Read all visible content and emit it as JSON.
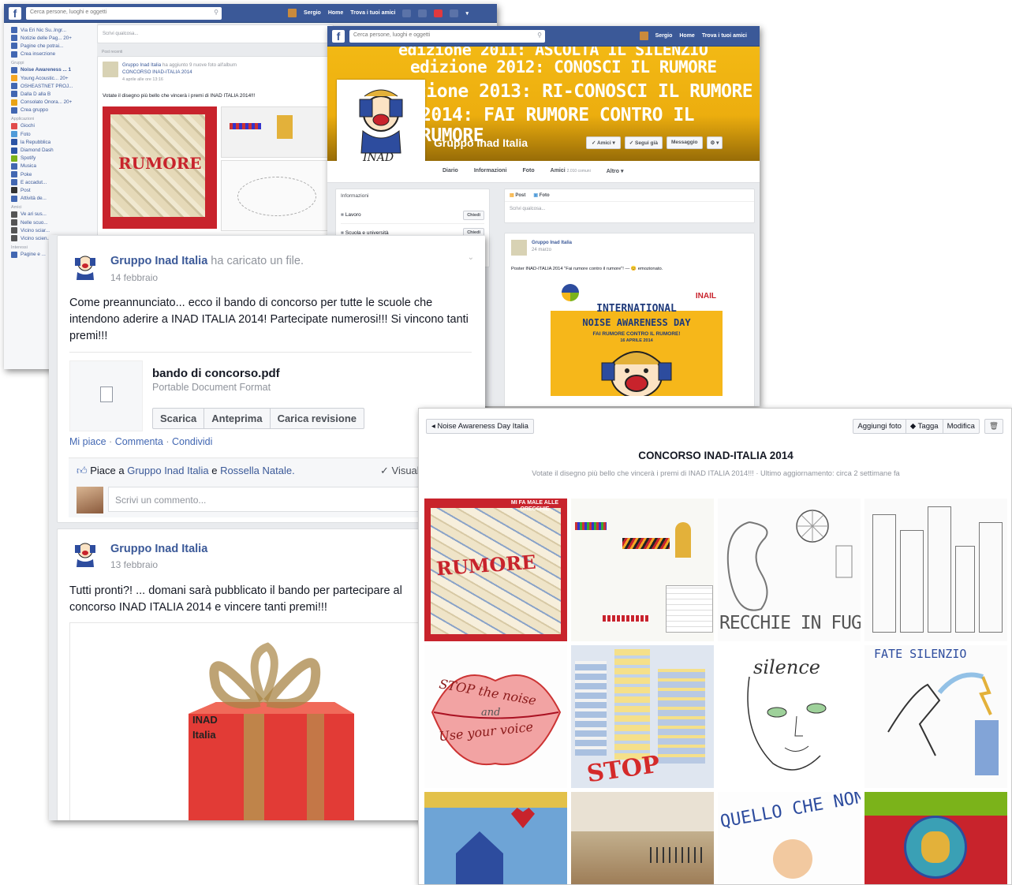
{
  "w1": {
    "search_placeholder": "Cerca persone, luoghi e oggetti",
    "nav": {
      "user": "Sergio",
      "home": "Home",
      "find_friends": "Trova i tuoi amici"
    },
    "sidebar": [
      {
        "label": "Via Eri Nic Su..Ingr...",
        "color": "#4267b2"
      },
      {
        "label": "Notizie delle Pag...  20+",
        "color": "#4267b2"
      },
      {
        "label": "Pagine che potrai...",
        "color": "#4267b2"
      },
      {
        "label": "Crea inserzione",
        "color": "#4267b2"
      },
      {
        "header": "Gruppi"
      },
      {
        "label": "Noise Awareness ... 1",
        "color": "#4267b2",
        "bold": true
      },
      {
        "label": "Young Acoustic...  20+",
        "color": "#f5a623"
      },
      {
        "label": "OSHEASTNET PROJ...",
        "color": "#4267b2"
      },
      {
        "label": "Dalla D alla B",
        "color": "#4267b2"
      },
      {
        "label": "Consolato Onora...  20+",
        "color": "#e8a317"
      },
      {
        "label": "Crea gruppo",
        "color": "#4267b2"
      },
      {
        "header": "Applicazioni"
      },
      {
        "label": "Giochi",
        "color": "#e14b4b"
      },
      {
        "label": "Foto",
        "color": "#4f9bd9"
      },
      {
        "label": "la Repubblica",
        "color": "#2c55a6"
      },
      {
        "label": "Diamond Dash",
        "color": "#2c55a6"
      },
      {
        "label": "Spotify",
        "color": "#7bb31a"
      },
      {
        "label": "Musica",
        "color": "#4267b2"
      },
      {
        "label": "Poke",
        "color": "#4267b2"
      },
      {
        "label": "E accadut...",
        "color": "#4267b2"
      },
      {
        "label": "Post",
        "color": "#333"
      },
      {
        "label": "Attività de...",
        "color": "#4267b2"
      },
      {
        "header": "Amici"
      },
      {
        "label": "Ve ari sus...",
        "color": "#555"
      },
      {
        "label": "Nelle scuo...",
        "color": "#555"
      },
      {
        "label": "Vicino sciar...",
        "color": "#555"
      },
      {
        "label": "Vicino scien...",
        "color": "#555"
      },
      {
        "header": "Interessi"
      },
      {
        "label": "Pagine e ...",
        "color": "#4267b2"
      }
    ],
    "composer_placeholder": "Scrivi qualcosa...",
    "recent_label": "Post recenti",
    "post": {
      "author": "Gruppo Inad Italia",
      "action": "ha aggiunto 9 nuove foto all'album",
      "album": "CONCORSO INAD-ITALIA 2014",
      "time": "4 aprile alle ore 13:16",
      "text": "Votate il disegno più bello che vincerà i premi di INAD ITALIA 2014!!!"
    }
  },
  "w2": {
    "search_placeholder": "Cerca persone, luoghi e oggetti",
    "nav": {
      "user": "Sergio",
      "home": "Home",
      "find_friends": "Trova i tuoi amici"
    },
    "cover_lines": [
      "edizione 2011: ASCOLTA IL SILENZIO",
      "edizione 2012: CONOSCI IL RUMORE",
      "edizione 2013: RI-CONOSCI IL RUMORE",
      "2014: FAI RUMORE CONTRO IL RUMORE"
    ],
    "group_name": "Gruppo Inad Italia",
    "buttons": {
      "friends": "✓ Amici ▾",
      "following": "✓ Segui già",
      "message": "Messaggio",
      "more": "⚙ ▾"
    },
    "tabs": [
      "Diario",
      "Informazioni",
      "Foto",
      "Amici",
      "Altro ▾"
    ],
    "friends_count": "2.010 comuni",
    "info_heading": "Informazioni",
    "info_rows": [
      {
        "label": "Lavoro",
        "btn": "Chiedi"
      },
      {
        "label": "Scuola e università",
        "btn": "Chiedi"
      }
    ],
    "composer": {
      "post": "Post",
      "photo": "Foto",
      "placeholder": "Scrivi qualcosa..."
    },
    "post": {
      "author": "Gruppo Inad Italia",
      "time": "24 marzo",
      "text": "Poster INAD-ITALIA 2014 \"Fai rumore contro il rumore\"! — 😊 emozionato.",
      "poster": {
        "brand": "INAIL",
        "line1": "INTERNATIONAL",
        "line2": "NOISE AWARENESS DAY",
        "line3": "FAI RUMORE CONTRO IL RUMORE!",
        "date": "16 APRILE 2014"
      }
    }
  },
  "w3": {
    "post1": {
      "author": "Gruppo Inad Italia",
      "action": "ha caricato un file.",
      "date": "14 febbraio",
      "text": "Come preannunciato... ecco il bando di concorso per tutte le scuole che intendono aderire a INAD ITALIA 2014! Partecipate numerosi!!! Si vincono tanti premi!!!",
      "file_name": "bando di concorso.pdf",
      "file_type": "Portable Document Format",
      "buttons": [
        "Scarica",
        "Anteprima",
        "Carica revisione"
      ],
      "actions": [
        "Mi piace",
        "Commenta",
        "Condividi"
      ],
      "likes_prefix": "Piace a",
      "liker1": "Gruppo Inad Italia",
      "likes_and": "e",
      "liker2": "Rossella Natale.",
      "seen": "✓ Visuali",
      "comment_placeholder": "Scrivi un commento..."
    },
    "post2": {
      "author": "Gruppo Inad Italia",
      "date": "13 febbraio",
      "text": "Tutti pronti?! ... domani sarà pubblicato il bando per partecipare al concorso INAD ITALIA 2014 e vincere tanti premi!!!",
      "gift_label_1": "INAD",
      "gift_label_2": "Italia"
    }
  },
  "w4": {
    "back": "◂ Noise Awareness Day Italia",
    "buttons": {
      "add_photos": "Aggiungi foto",
      "tag": "Tagga",
      "edit": "Modifica"
    },
    "title": "CONCORSO INAD-ITALIA 2014",
    "subtitle": "Votate il disegno più bello che vincerà i premi di INAD ITALIA 2014!!! · Ultimo aggiornamento: circa 2 settimane fa",
    "photo_texts": {
      "p1": "RUMORE",
      "p1b": "MI FA MALE ALLE ORECCHIE",
      "p3": "RECCHIE IN FUGA",
      "p5a": "STOP the noise",
      "p5b": "and",
      "p5c": "Use your voice",
      "p6": "STOP",
      "p7": "silence",
      "p8": "FATE SILENZIO",
      "p11": "QUELLO CHE NON"
    }
  }
}
